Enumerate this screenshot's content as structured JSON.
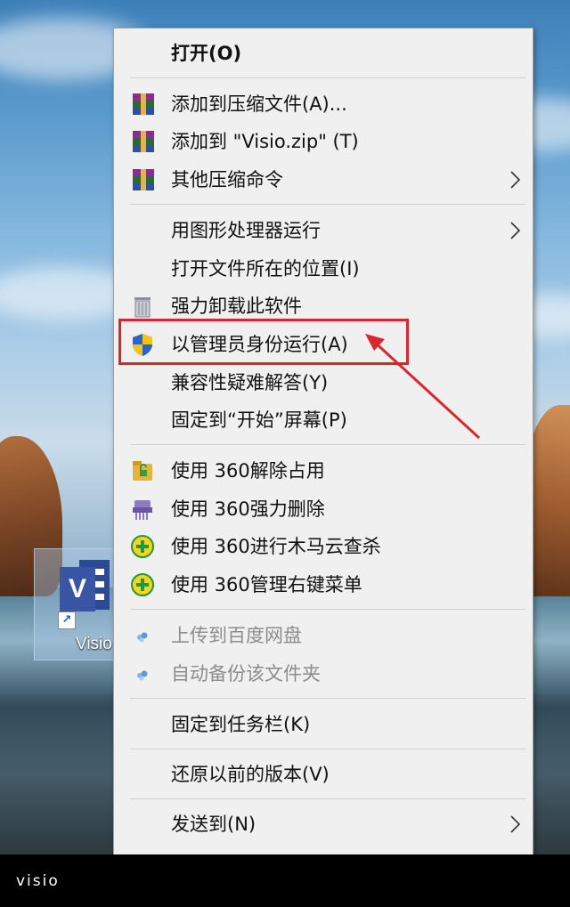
{
  "menu": {
    "items": [
      {
        "label": "打开(O)"
      },
      {
        "label": "添加到压缩文件(A)..."
      },
      {
        "label": "添加到 \"Visio.zip\" (T)"
      },
      {
        "label": "其他压缩命令"
      },
      {
        "label": "用图形处理器运行"
      },
      {
        "label": "打开文件所在的位置(I)"
      },
      {
        "label": "强力卸载此软件"
      },
      {
        "label": "以管理员身份运行(A)"
      },
      {
        "label": "兼容性疑难解答(Y)"
      },
      {
        "label": "固定到“开始”屏幕(P)"
      },
      {
        "label": "使用 360解除占用"
      },
      {
        "label": "使用 360强力删除"
      },
      {
        "label": "使用 360进行木马云查杀"
      },
      {
        "label": "使用 360管理右键菜单"
      },
      {
        "label": "上传到百度网盘",
        "disabled": true
      },
      {
        "label": "自动备份该文件夹",
        "disabled": true
      },
      {
        "label": "固定到任务栏(K)"
      },
      {
        "label": "还原以前的版本(V)"
      },
      {
        "label": "发送到(N)"
      }
    ]
  },
  "icons": {
    "archive": "winrar-archive-icon",
    "uninstall": "uninstall-trash-icon",
    "admin": "uac-shield-icon",
    "unlock": "360-unlock-icon",
    "shred": "360-shred-icon",
    "scan": "360-scan-icon",
    "cloud": "baidu-cloud-icon",
    "submenu": "chevron-right-icon"
  },
  "desktop": {
    "icon_label": "Visio",
    "icon_letter": "V"
  },
  "caption": "visio",
  "colors": {
    "menu_bg": "#f0f0f0",
    "highlight": "#d8282e",
    "separator": "#cfcfcf",
    "disabled_text": "#8c8c8c"
  }
}
